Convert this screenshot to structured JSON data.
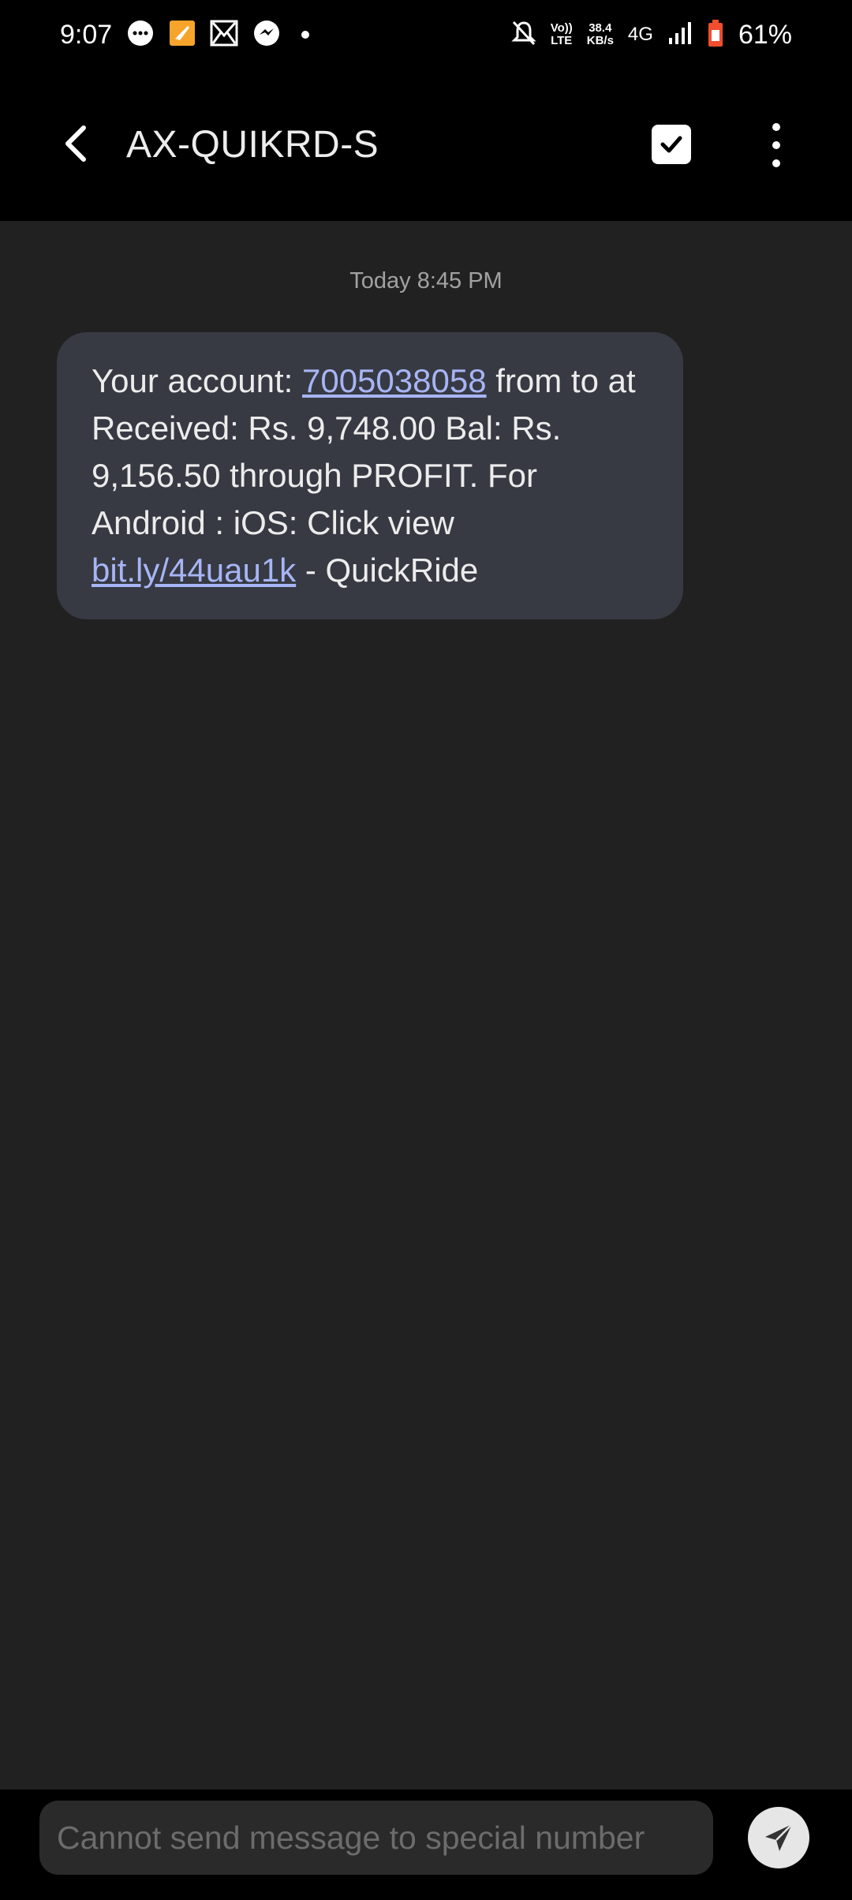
{
  "status_bar": {
    "time": "9:07",
    "notification_icons": [
      "message-icon",
      "app-notification-icon",
      "gmail-like-icon",
      "messenger-icon"
    ],
    "volte": "Vo))\nLTE",
    "speed_value": "38.4",
    "speed_unit": "KB/s",
    "network": "4G",
    "battery": "61%"
  },
  "app_bar": {
    "title": "AX-QUIKRD-S"
  },
  "conversation": {
    "timestamp": "Today 8:45 PM",
    "message": {
      "part1": "Your account: ",
      "phone_link": "7005038058",
      "part2": " from to at Received: Rs. 9,748.00  Bal: Rs. 9,156.50  through PROFIT. For Android : iOS: Click view ",
      "url_link": "bit.ly/44uau1k",
      "part3": "  - QuickRide"
    }
  },
  "composer": {
    "placeholder": "Cannot send message to special number"
  },
  "colors": {
    "background": "#212121",
    "bubble": "#373a43",
    "link": "#a7b5f5",
    "battery": "#f04e2f"
  }
}
